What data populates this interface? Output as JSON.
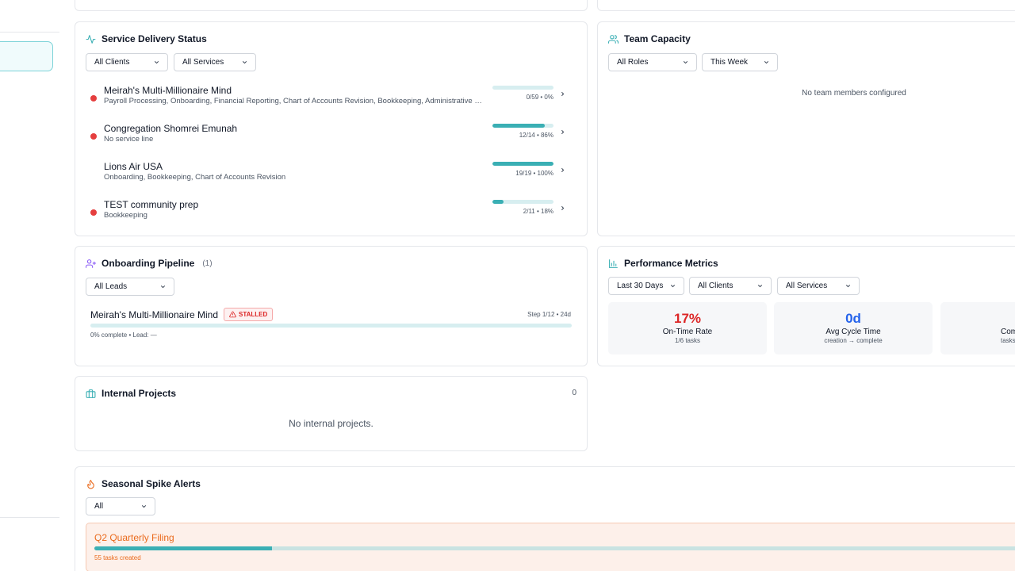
{
  "service_delivery": {
    "title": "Service Delivery Status",
    "filters": [
      "All Clients",
      "All Services"
    ],
    "rows": [
      {
        "name": "Meirah's Multi-Millionaire Mind",
        "services": "Payroll Processing, Onboarding, Financial Reporting, Chart of Accounts Revision, Bookkeeping, Administrative Support, Tax Preparation",
        "stat": "0/59 • 0%",
        "progress": 0,
        "alert": true
      },
      {
        "name": "Congregation Shomrei Emunah",
        "services": "No service line",
        "stat": "12/14 • 86%",
        "progress": 86,
        "alert": true
      },
      {
        "name": "Lions Air USA",
        "services": "Onboarding, Bookkeeping, Chart of Accounts Revision",
        "stat": "19/19 • 100%",
        "progress": 100,
        "alert": false
      },
      {
        "name": "TEST community prep",
        "services": "Bookkeeping",
        "stat": "2/11 • 18%",
        "progress": 18,
        "alert": true
      }
    ]
  },
  "team_capacity": {
    "title": "Team Capacity",
    "filters": [
      "All Roles",
      "This Week"
    ],
    "empty": "No team members configured"
  },
  "onboarding": {
    "title": "Onboarding Pipeline",
    "count": "(1)",
    "filter": "All Leads",
    "item": {
      "name": "Meirah's Multi-Millionaire Mind",
      "badge": "STALLED",
      "step": "Step 1/12 • 24d",
      "meta": "0% complete • Lead: —",
      "progress": 0
    }
  },
  "performance": {
    "title": "Performance Metrics",
    "filters": [
      "Last 30 Days",
      "All Clients",
      "All Services"
    ],
    "metrics": [
      {
        "value": "17%",
        "label": "On-Time Rate",
        "sub": "1/6 tasks",
        "color": "#dc2626"
      },
      {
        "value": "0d",
        "label": "Avg Cycle Time",
        "sub": "creation → complete",
        "color": "#2563eb"
      },
      {
        "value": "",
        "label": "Com",
        "sub": "tasks",
        "color": "#111827"
      }
    ]
  },
  "internal_projects": {
    "title": "Internal Projects",
    "count": "0",
    "empty": "No internal projects."
  },
  "seasonal": {
    "title": "Seasonal Spike Alerts",
    "filter": "All",
    "alert": {
      "title": "Q2 Quarterly Filing",
      "sub": "55 tasks created",
      "progress": 19
    }
  },
  "colors": {
    "accent": "#3aafb4",
    "alert_red": "#e53e3e",
    "warn_orange": "#ea6a1c"
  }
}
